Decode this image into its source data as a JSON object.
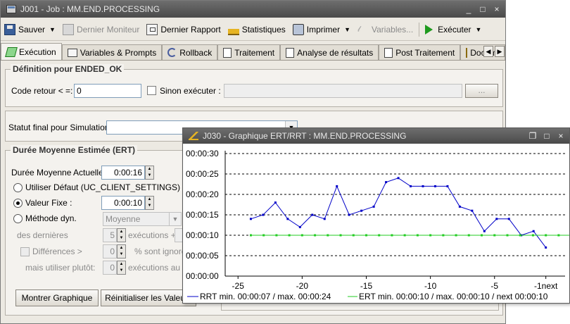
{
  "main_window": {
    "title": "J001 - Job : MM.END.PROCESSING",
    "controls": {
      "minimize": "_",
      "maximize": "□",
      "close": "×"
    }
  },
  "toolbar": {
    "save": "Sauver",
    "last_monitor": "Dernier Moniteur",
    "last_report": "Dernier Rapport",
    "statistics": "Statistiques",
    "print": "Imprimer",
    "variables": "Variables...",
    "execute": "Exécuter"
  },
  "tabs": [
    {
      "label": "Exécution",
      "active": true
    },
    {
      "label": "Variables & Prompts"
    },
    {
      "label": "Rollback"
    },
    {
      "label": "Traitement"
    },
    {
      "label": "Analyse de résultats"
    },
    {
      "label": "Post Traitement"
    },
    {
      "label": "Documentati"
    }
  ],
  "definition": {
    "legend": "Définition pour ENDED_OK",
    "return_code_label": "Code retour < =:",
    "return_code_value": "0",
    "else_execute_label": "Sinon exécuter :",
    "browse_button": "..."
  },
  "simulation": {
    "label": "Statut final pour Simulation:",
    "value": ""
  },
  "ert": {
    "legend": "Durée Moyenne Estimée (ERT)",
    "current_label": "Durée Moyenne Actuelle:",
    "current_value": "0:00:16",
    "default_label": "Utiliser Défaut (UC_CLIENT_SETTINGS)",
    "fixed_label": "Valeur Fixe :",
    "fixed_value": "0:00:10",
    "dynamic_label": "Méthode dyn.",
    "dynamic_value": "Moyenne",
    "last_label": "des dernières",
    "last_value": "5",
    "executions_label": "exécutions +",
    "differences_label": "Différences >",
    "differences_value": "0",
    "ignored_label": "% sont ignorée",
    "instead_label": "mais utiliser plutôt:",
    "instead_value": "0",
    "instead_unit": "exécutions au mi",
    "show_graph_button": "Montrer Graphique",
    "reset_button": "Réinitialiser les Valeurs"
  },
  "graph_window": {
    "title": "J030 - Graphique ERT/RRT : MM.END.PROCESSING",
    "controls": {
      "restore": "❐",
      "maximize": "□",
      "close": "×"
    }
  },
  "chart_data": {
    "type": "line",
    "x": [
      -24,
      -23,
      -22,
      -21,
      -20,
      -19,
      -18,
      -17,
      -16,
      -15,
      -14,
      -13,
      -12,
      -11,
      -10,
      -9,
      -8,
      -7,
      -6,
      -5,
      -4,
      -3,
      -2,
      -1
    ],
    "x_ticks": [
      -25,
      -20,
      -15,
      -10,
      -5
    ],
    "x_tick_labels": [
      "-25",
      "-20",
      "-15",
      "-10",
      "-5",
      "-1next"
    ],
    "xlim": [
      -26,
      0.5
    ],
    "y_ticks": [
      0,
      5,
      10,
      15,
      20,
      25,
      30
    ],
    "y_tick_labels": [
      "00:00:00",
      "00:00:05",
      "00:00:10",
      "00:00:15",
      "00:00:20",
      "00:00:25",
      "00:00:30"
    ],
    "ylim": [
      0,
      30
    ],
    "grid": "horizontal dashed",
    "legend_placement": "bottom",
    "series": [
      {
        "name": "RRT min. 00:00:07 / max. 00:00:24",
        "color": "#0000c8",
        "values": [
          14,
          15,
          18,
          14,
          12,
          15,
          14,
          22,
          15,
          16,
          17,
          23,
          24,
          22,
          22,
          22,
          22,
          17,
          16,
          11,
          14,
          14,
          10,
          11,
          7
        ]
      },
      {
        "name": "ERT min. 00:00:10 / max. 00:00:10 / next 00:00:10",
        "color": "#22cc22",
        "values": [
          10,
          10,
          10,
          10,
          10,
          10,
          10,
          10,
          10,
          10,
          10,
          10,
          10,
          10,
          10,
          10,
          10,
          10,
          10,
          10,
          10,
          10,
          10,
          10,
          10,
          10
        ]
      }
    ]
  }
}
